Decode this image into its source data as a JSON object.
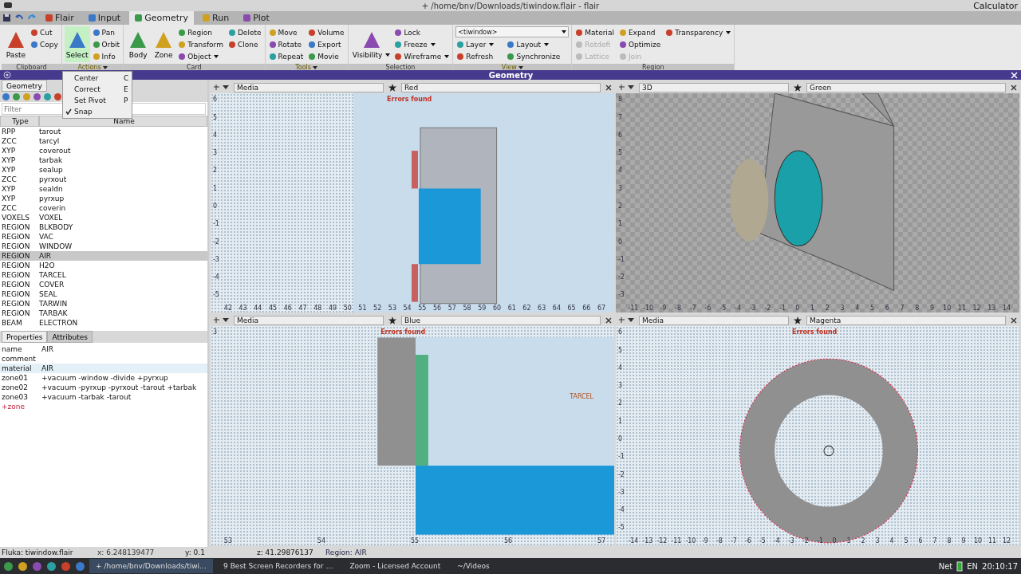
{
  "window": {
    "title": "+ /home/bnv/Downloads/tiwindow.flair - flair",
    "side_title": "Calculator"
  },
  "menu_tabs": [
    {
      "label": "Flair",
      "selected": false
    },
    {
      "label": "Input",
      "selected": false
    },
    {
      "label": "Geometry",
      "selected": true
    },
    {
      "label": "Run",
      "selected": false
    },
    {
      "label": "Plot",
      "selected": false
    }
  ],
  "ribbon": [
    {
      "title": "Clipboard",
      "has_menu": false,
      "large": [
        {
          "label": "Paste",
          "selected": false
        }
      ],
      "small": [
        {
          "label": "Cut",
          "dropdown": false,
          "disabled": false
        },
        {
          "label": "Copy",
          "dropdown": false,
          "disabled": false
        }
      ]
    },
    {
      "title": "Actions",
      "has_menu": true,
      "large": [
        {
          "label": "Select",
          "selected": true
        }
      ],
      "small": [
        {
          "label": "Pan",
          "dropdown": false,
          "disabled": false
        },
        {
          "label": "Orbit",
          "dropdown": false,
          "disabled": false
        },
        {
          "label": "Info",
          "dropdown": false,
          "disabled": false
        }
      ]
    },
    {
      "title": "Card",
      "has_menu": false,
      "large": [
        {
          "label": "Body",
          "selected": false
        },
        {
          "label": "Zone",
          "selected": false
        }
      ],
      "small": [
        {
          "label": "Region",
          "dropdown": false,
          "disabled": false
        },
        {
          "label": "Transform",
          "dropdown": false,
          "disabled": false
        },
        {
          "label": "Object",
          "dropdown": true,
          "disabled": false
        },
        {
          "label": "Delete",
          "dropdown": false,
          "disabled": false
        },
        {
          "label": "Clone",
          "dropdown": false,
          "disabled": false
        }
      ]
    },
    {
      "title": "Tools",
      "has_menu": true,
      "small": [
        {
          "label": "Move",
          "dropdown": false,
          "disabled": false
        },
        {
          "label": "Rotate",
          "dropdown": false,
          "disabled": false
        },
        {
          "label": "Repeat",
          "dropdown": false,
          "disabled": false
        },
        {
          "label": "Volume",
          "dropdown": false,
          "disabled": false
        },
        {
          "label": "Export",
          "dropdown": false,
          "disabled": false
        },
        {
          "label": "Movie",
          "dropdown": false,
          "disabled": false
        }
      ]
    },
    {
      "title": "Selection",
      "has_menu": false,
      "large": [
        {
          "label": "Visibility",
          "selected": false,
          "dropdown": true
        }
      ],
      "small": [
        {
          "label": "Lock",
          "dropdown": false,
          "disabled": false
        },
        {
          "label": "Freeze",
          "dropdown": true,
          "disabled": false
        },
        {
          "label": "Wireframe",
          "dropdown": true,
          "disabled": false
        }
      ]
    },
    {
      "title": "View",
      "has_menu": true,
      "combo": "<tiwindow>",
      "small": [
        {
          "label": "Layer",
          "dropdown": true,
          "disabled": false
        },
        {
          "label": "Refresh",
          "dropdown": false,
          "disabled": false
        },
        {
          "label": "Layout",
          "dropdown": true,
          "disabled": false
        },
        {
          "label": "Synchronize",
          "dropdown": false,
          "disabled": false
        }
      ]
    },
    {
      "title": "Region",
      "has_menu": false,
      "small": [
        {
          "label": "Material",
          "dropdown": false,
          "disabled": false
        },
        {
          "label": "Rotdefi",
          "dropdown": false,
          "disabled": true
        },
        {
          "label": "Lattice",
          "dropdown": false,
          "disabled": true
        },
        {
          "label": "Expand",
          "dropdown": false,
          "disabled": false
        },
        {
          "label": "Optimize",
          "dropdown": false,
          "disabled": false
        },
        {
          "label": "Join",
          "dropdown": false,
          "disabled": true
        },
        {
          "label": "Transparency",
          "dropdown": true,
          "disabled": false
        }
      ]
    }
  ],
  "actions_menu": [
    {
      "label": "Center",
      "shortcut": "C",
      "checked": false
    },
    {
      "label": "Correct",
      "shortcut": "E",
      "checked": false
    },
    {
      "label": "Set Pivot",
      "shortcut": "P",
      "checked": false
    },
    {
      "label": "Snap",
      "checked": true
    }
  ],
  "frame_title": "Geometry",
  "left_tabs": [
    {
      "label": "Geometry",
      "selected": true
    }
  ],
  "filter": {
    "placeholder": "Filter"
  },
  "table": {
    "columns": [
      "Type",
      "Name"
    ],
    "rows": [
      {
        "type": "RPP",
        "name": "tarout",
        "selected": false
      },
      {
        "type": "ZCC",
        "name": "tarcyl",
        "selected": false
      },
      {
        "type": "XYP",
        "name": "coverout",
        "selected": false
      },
      {
        "type": "XYP",
        "name": "tarbak",
        "selected": false
      },
      {
        "type": "XYP",
        "name": "sealup",
        "selected": false
      },
      {
        "type": "ZCC",
        "name": "pyrxout",
        "selected": false
      },
      {
        "type": "XYP",
        "name": "sealdn",
        "selected": false
      },
      {
        "type": "XYP",
        "name": "pyrxup",
        "selected": false
      },
      {
        "type": "ZCC",
        "name": "coverin",
        "selected": false
      },
      {
        "type": "VOXELS",
        "name": "VOXEL",
        "selected": false
      },
      {
        "type": "REGION",
        "name": "BLKBODY",
        "selected": false
      },
      {
        "type": "REGION",
        "name": "VAC",
        "selected": false
      },
      {
        "type": "REGION",
        "name": "WINDOW",
        "selected": false
      },
      {
        "type": "REGION",
        "name": "AIR",
        "selected": true
      },
      {
        "type": "REGION",
        "name": "H2O",
        "selected": false
      },
      {
        "type": "REGION",
        "name": "TARCEL",
        "selected": false
      },
      {
        "type": "REGION",
        "name": "COVER",
        "selected": false
      },
      {
        "type": "REGION",
        "name": "SEAL",
        "selected": false
      },
      {
        "type": "REGION",
        "name": "TARWIN",
        "selected": false
      },
      {
        "type": "REGION",
        "name": "TARBAK",
        "selected": false
      },
      {
        "type": "BEAM",
        "name": "ELECTRON",
        "selected": false
      }
    ]
  },
  "prop_tabs": [
    {
      "label": "Properties",
      "selected": true
    },
    {
      "label": "Attributes",
      "selected": false
    }
  ],
  "properties": [
    {
      "key": "name",
      "value": "AIR",
      "kind": "field",
      "selected": false
    },
    {
      "key": "comment",
      "kind": "field",
      "selected": false
    },
    {
      "key": "material",
      "value": "AIR",
      "kind": "field",
      "selected": true
    },
    {
      "key": "zone01",
      "value": "+vacuum -window -divide +pyrxup",
      "kind": "field",
      "selected": false
    },
    {
      "key": "zone02",
      "value": "+vacuum -pyrxup -pyrxout -tarout +tarbak",
      "kind": "field",
      "selected": false
    },
    {
      "key": "zone03",
      "value": "+vacuum -tarbak -tarout",
      "kind": "field",
      "selected": false
    },
    {
      "key": "+zone",
      "kind": "add",
      "selected": false
    }
  ],
  "viewports": [
    {
      "kind": "side",
      "layer": "Media",
      "color_name": "Red",
      "message": "Errors found",
      "xticks": [
        "42",
        "43",
        "44",
        "45",
        "46",
        "47",
        "48",
        "49",
        "50",
        "51",
        "52",
        "53",
        "54",
        "55",
        "56",
        "57",
        "58",
        "59",
        "60",
        "61",
        "62",
        "63",
        "64",
        "65",
        "66",
        "67"
      ],
      "yticks": [
        "6",
        "5",
        "4",
        "3",
        "2",
        "1",
        "0",
        "-1",
        "-2",
        "-3",
        "-4",
        "-5"
      ]
    },
    {
      "kind": "perspective",
      "layer": "3D",
      "color_name": "Green",
      "xticks": [
        "-11",
        "-10",
        "-9",
        "-8",
        "-7",
        "-6",
        "-5",
        "-4",
        "-3",
        "-2",
        "-1",
        "0",
        "1",
        "2",
        "3",
        "4",
        "5",
        "6",
        "7",
        "8",
        "9",
        "10",
        "11",
        "12",
        "13",
        "14"
      ],
      "yticks": [
        "8",
        "7",
        "6",
        "5",
        "4",
        "3",
        "2",
        "1",
        "0",
        "-1",
        "-2",
        "-3"
      ]
    },
    {
      "kind": "top",
      "layer": "Media",
      "color_name": "Blue",
      "message": "Errors found",
      "label": "TARCEL",
      "xticks": [
        "53",
        "54",
        "55",
        "56",
        "57"
      ],
      "yticks": [
        "3"
      ]
    },
    {
      "kind": "front",
      "layer": "Media",
      "color_name": "Magenta",
      "message": "Errors found",
      "xticks": [
        "-14",
        "-13",
        "-12",
        "-11",
        "-10",
        "-9",
        "-8",
        "-7",
        "-6",
        "-5",
        "-4",
        "-3",
        "-2",
        "-1",
        "0",
        "1",
        "2",
        "3",
        "4",
        "5",
        "6",
        "7",
        "8",
        "9",
        "10",
        "11",
        "12"
      ],
      "yticks": [
        "6",
        "5",
        "4",
        "3",
        "2",
        "1",
        "0",
        "-1",
        "-2",
        "-3",
        "-4",
        "-5"
      ]
    }
  ],
  "status_bar": {
    "file": "Fluka: tiwindow.flair",
    "x": "x: 6.248139477",
    "y": "y: 0.1",
    "z": "z: 41.29876137",
    "region": "Region: AIR"
  },
  "taskbar": {
    "tasks": [
      {
        "label": "+ /home/bnv/Downloads/tiwi…",
        "selected": true
      },
      {
        "label": "9 Best Screen Recorders for …",
        "selected": false
      },
      {
        "label": "Zoom - Licensed Account",
        "selected": false
      },
      {
        "label": "~/Videos",
        "selected": false
      }
    ],
    "net": "Net",
    "lang": "EN",
    "time": "20:10:17"
  }
}
